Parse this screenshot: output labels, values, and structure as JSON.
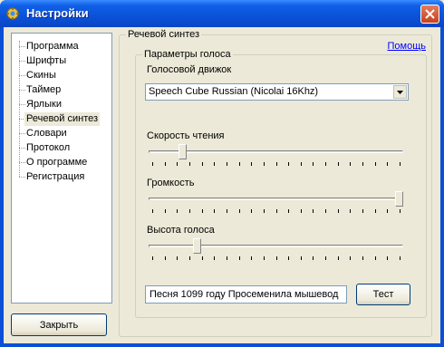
{
  "window": {
    "title": "Настройки",
    "title_bar_color": "#0a52d8",
    "icon": "settings-app-icon",
    "close_icon": "close-icon"
  },
  "sidebar": {
    "items": [
      {
        "label": "Программа",
        "selected": false
      },
      {
        "label": "Шрифты",
        "selected": false
      },
      {
        "label": "Скины",
        "selected": false
      },
      {
        "label": "Таймер",
        "selected": false
      },
      {
        "label": "Ярлыки",
        "selected": false
      },
      {
        "label": "Речевой синтез",
        "selected": true
      },
      {
        "label": "Словари",
        "selected": false
      },
      {
        "label": "Протокол",
        "selected": false
      },
      {
        "label": "О программе",
        "selected": false
      },
      {
        "label": "Регистрация",
        "selected": false
      }
    ],
    "close_button": "Закрыть"
  },
  "main": {
    "section_title": "Речевой синтез",
    "help_link": "Помощь",
    "voice_params": {
      "title": "Параметры голоса",
      "engine_label": "Голосовой движок",
      "engine_value": "Speech Cube Russian (Nicolai 16Khz)",
      "speed_label": "Скорость чтения",
      "speed_level": 0.12,
      "volume_label": "Громкость",
      "volume_level": 1.0,
      "pitch_label": "Высота голоса",
      "pitch_level": 0.18,
      "slider_ticks": 20,
      "test_text": "Песня 1099 году Просеменила мышевод",
      "test_button": "Тест"
    }
  }
}
